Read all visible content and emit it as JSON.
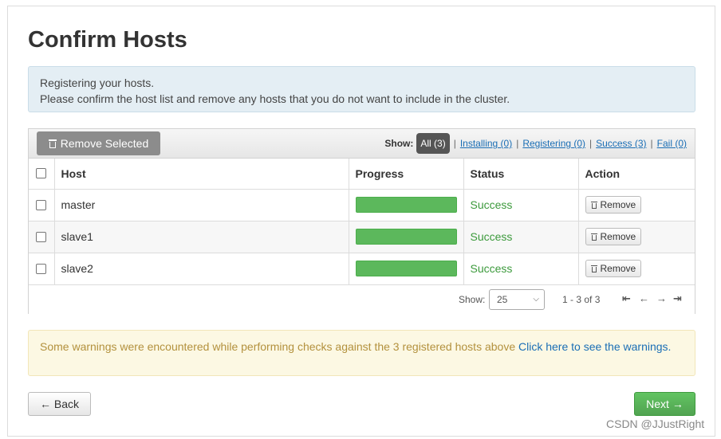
{
  "page": {
    "title": "Confirm Hosts"
  },
  "info": {
    "line1": "Registering your hosts.",
    "line2": "Please confirm the host list and remove any hosts that you do not want to include in the cluster."
  },
  "toolbar": {
    "remove_selected_label": "Remove Selected",
    "show_label": "Show:",
    "filters": {
      "all": "All (3)",
      "installing": "Installing (0)",
      "registering": "Registering (0)",
      "success": "Success (3)",
      "fail": "Fail (0)"
    }
  },
  "table": {
    "headers": {
      "host": "Host",
      "progress": "Progress",
      "status": "Status",
      "action": "Action"
    },
    "rows": [
      {
        "host": "master",
        "progress": 1.0,
        "status": "Success",
        "action": "Remove"
      },
      {
        "host": "slave1",
        "progress": 1.0,
        "status": "Success",
        "action": "Remove"
      },
      {
        "host": "slave2",
        "progress": 1.0,
        "status": "Success",
        "action": "Remove"
      }
    ]
  },
  "pager": {
    "show_label": "Show:",
    "page_size": "25",
    "range": "1 - 3 of 3"
  },
  "warning": {
    "text": "Some warnings were encountered while performing checks against the 3 registered hosts above ",
    "link": "Click here to see the warnings."
  },
  "footer": {
    "back_label": "← Back",
    "next_label": "Next →",
    "watermark": "CSDN @JJustRight"
  },
  "colors": {
    "success": "#5cb85c",
    "link": "#1a6eb5",
    "warning_text": "#b3913d"
  }
}
